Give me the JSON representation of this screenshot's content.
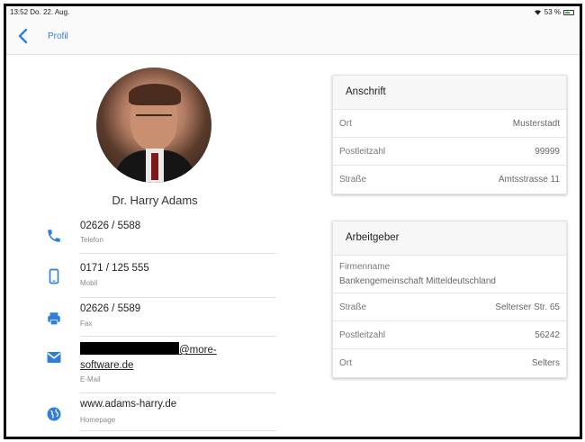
{
  "status": {
    "time": "13:52",
    "date": "Do. 22. Aug.",
    "battery": "53 %"
  },
  "nav": {
    "back_label": "Profil"
  },
  "person": {
    "name": "Dr. Harry Adams"
  },
  "contacts": [
    {
      "icon": "phone-icon",
      "value": "02626 / 5588",
      "label": "Telefon"
    },
    {
      "icon": "mobile-icon",
      "value": "0171 / 125 555",
      "label": "Mobil"
    },
    {
      "icon": "fax-icon",
      "value": "02626 / 5589",
      "label": "Fax"
    },
    {
      "icon": "mail-icon",
      "value_suffix": "@more-",
      "value_line2": "software.de",
      "label": "E-Mail"
    },
    {
      "icon": "globe-icon",
      "value": "www.adams-harry.de",
      "label": "Homepage"
    }
  ],
  "address_card": {
    "title": "Anschrift",
    "rows": [
      {
        "key": "Ort",
        "value": "Musterstadt"
      },
      {
        "key": "Postleitzahl",
        "value": "99999"
      },
      {
        "key": "Straße",
        "value": "Amtsstrasse 11"
      }
    ]
  },
  "employer_card": {
    "title": "Arbeitgeber",
    "company_key": "Firmenname",
    "company_value": "Bankengemeinschaft Mitteldeutschland",
    "rows": [
      {
        "key": "Straße",
        "value": "Selterser Str. 65"
      },
      {
        "key": "Postleitzahl",
        "value": "56242"
      },
      {
        "key": "Ort",
        "value": "Selters"
      }
    ]
  },
  "colors": {
    "accent": "#2f7fd8",
    "icon_blue": "#2f7fd8"
  }
}
